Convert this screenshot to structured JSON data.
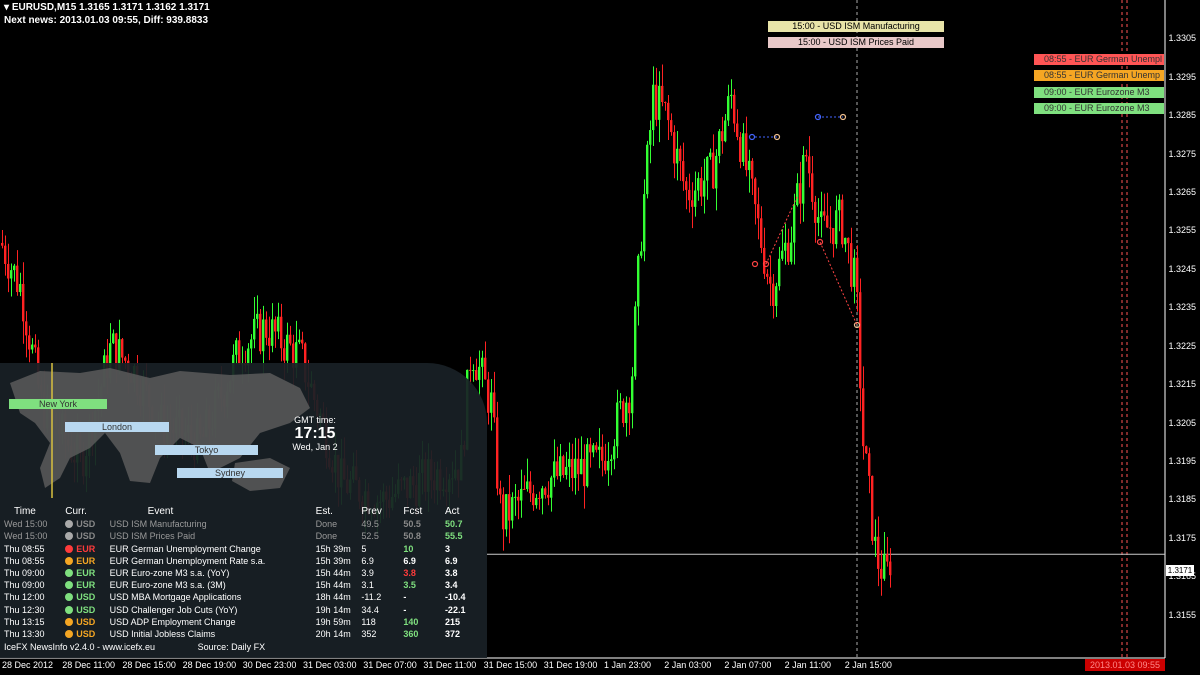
{
  "header": {
    "symbol_line": "EURUSD,M15  1.3165 1.3171 1.3162 1.3171",
    "next_news": "Next news: 2013.01.03 09:55, Diff: 939.8833"
  },
  "colors": {
    "bull": "#33ff33",
    "bear": "#ff2222",
    "background": "#000000",
    "high_impact": "#ff3b3b",
    "medium_impact": "#f5a623",
    "low_impact": "#7fe07f"
  },
  "chart_data": {
    "type": "candlestick",
    "title": "",
    "symbol": "EURUSD",
    "timeframe": "M15",
    "ylim": [
      1.315,
      1.331
    ],
    "current_price": "1.3171",
    "price_ticks": [
      "1.3305",
      "1.3295",
      "1.3285",
      "1.3275",
      "1.3265",
      "1.3255",
      "1.3245",
      "1.3235",
      "1.3225",
      "1.3215",
      "1.3205",
      "1.3195",
      "1.3185",
      "1.3175",
      "1.3165",
      "1.3155"
    ],
    "time_ticks": [
      "28 Dec 2012",
      "28 Dec 11:00",
      "28 Dec 15:00",
      "28 Dec 19:00",
      "30 Dec 23:00",
      "31 Dec 03:00",
      "31 Dec 07:00",
      "31 Dec 11:00",
      "31 Dec 15:00",
      "31 Dec 19:00",
      "1 Jan 23:00",
      "2 Jan 03:00",
      "2 Jan 07:00",
      "2 Jan 11:00",
      "2 Jan 15:00"
    ],
    "server_time": "2013.01.03 09:55"
  },
  "news_markers_top": [
    {
      "label": "15:00 - USD ISM Manufacturing",
      "color": "#e8e4a8"
    },
    {
      "label": "15:00 - USD ISM Prices Paid",
      "color": "#e8c8c8"
    }
  ],
  "news_markers_right": [
    {
      "label": "08:55 - EUR German Unempl",
      "color": "#ff5555"
    },
    {
      "label": "08:55 - EUR German Unemp",
      "color": "#f5a623"
    },
    {
      "label": "09:00 - EUR Eurozone M3",
      "color": "#7fe07f"
    },
    {
      "label": "09:00 - EUR Eurozone M3",
      "color": "#7fe07f"
    }
  ],
  "sessions": [
    {
      "name": "New York",
      "color": "#7fe07f"
    },
    {
      "name": "London",
      "color": "#b8d8f0"
    },
    {
      "name": "Tokyo",
      "color": "#b8d8f0"
    },
    {
      "name": "Sydney",
      "color": "#b8d8f0"
    }
  ],
  "gmt": {
    "label": "GMT time:",
    "time": "17:15",
    "date": "Wed, Jan 2"
  },
  "table": {
    "headers": [
      "Time",
      "Curr.",
      "Event",
      "Est.",
      "Prev",
      "Fcst",
      "Act"
    ],
    "rows": [
      {
        "day": "Wed",
        "time": "15:00",
        "dot": "#aaaaaa",
        "curr": "USD",
        "event": "USD ISM Manufacturing",
        "est": "Done",
        "prev": "49.5",
        "fcst": "50.5",
        "act": "50.7",
        "dim": true,
        "curr_color": "#888888",
        "fcst_color": "#888888",
        "act_color": "#7fe07f"
      },
      {
        "day": "Wed",
        "time": "15:00",
        "dot": "#aaaaaa",
        "curr": "USD",
        "event": "USD ISM Prices Paid",
        "est": "Done",
        "prev": "52.5",
        "fcst": "50.8",
        "act": "55.5",
        "dim": true,
        "curr_color": "#888888",
        "fcst_color": "#888888",
        "act_color": "#7fe07f"
      },
      {
        "day": "Thu",
        "time": "08:55",
        "dot": "#ff3b3b",
        "curr": "EUR",
        "event": "EUR German Unemployment Change",
        "est": "15h 39m",
        "prev": "5",
        "fcst": "10",
        "act": "3",
        "dim": false,
        "curr_color": "#ff3b3b",
        "fcst_color": "#7fe07f",
        "act_color": "#ffffff"
      },
      {
        "day": "Thu",
        "time": "08:55",
        "dot": "#f5a623",
        "curr": "EUR",
        "event": "EUR German Unemployment Rate s.a.",
        "est": "15h 39m",
        "prev": "6.9",
        "fcst": "6.9",
        "act": "6.9",
        "dim": false,
        "curr_color": "#f5a623",
        "fcst_color": "#ffffff",
        "act_color": "#ffffff"
      },
      {
        "day": "Thu",
        "time": "09:00",
        "dot": "#7fe07f",
        "curr": "EUR",
        "event": "EUR Euro-zone M3 s.a. (YoY)",
        "est": "15h 44m",
        "prev": "3.9",
        "fcst": "3.8",
        "act": "3.8",
        "dim": false,
        "curr_color": "#7fe07f",
        "fcst_color": "#ff3b3b",
        "act_color": "#ffffff"
      },
      {
        "day": "Thu",
        "time": "09:00",
        "dot": "#7fe07f",
        "curr": "EUR",
        "event": "EUR Euro-zone M3 s.a. (3M)",
        "est": "15h 44m",
        "prev": "3.1",
        "fcst": "3.5",
        "act": "3.4",
        "dim": false,
        "curr_color": "#7fe07f",
        "fcst_color": "#7fe07f",
        "act_color": "#ffffff"
      },
      {
        "day": "Thu",
        "time": "12:00",
        "dot": "#7fe07f",
        "curr": "USD",
        "event": "USD MBA Mortgage Applications",
        "est": "18h 44m",
        "prev": "-11.2",
        "fcst": "-",
        "act": "-10.4",
        "dim": false,
        "curr_color": "#7fe07f",
        "fcst_color": "#ffffff",
        "act_color": "#ffffff"
      },
      {
        "day": "Thu",
        "time": "12:30",
        "dot": "#7fe07f",
        "curr": "USD",
        "event": "USD Challenger Job Cuts (YoY)",
        "est": "19h 14m",
        "prev": "34.4",
        "fcst": "-",
        "act": "-22.1",
        "dim": false,
        "curr_color": "#7fe07f",
        "fcst_color": "#ffffff",
        "act_color": "#ffffff"
      },
      {
        "day": "Thu",
        "time": "13:15",
        "dot": "#f5a623",
        "curr": "USD",
        "event": "USD ADP Employment Change",
        "est": "19h 59m",
        "prev": "118",
        "fcst": "140",
        "act": "215",
        "dim": false,
        "curr_color": "#f5a623",
        "fcst_color": "#7fe07f",
        "act_color": "#ffffff"
      },
      {
        "day": "Thu",
        "time": "13:30",
        "dot": "#f5a623",
        "curr": "USD",
        "event": "USD Initial Jobless Claims",
        "est": "20h 14m",
        "prev": "352",
        "fcst": "360",
        "act": "372",
        "dim": false,
        "curr_color": "#f5a623",
        "fcst_color": "#7fe07f",
        "act_color": "#ffffff"
      }
    ]
  },
  "footer": {
    "version": "IceFX NewsInfo v2.4.0  -  www.icefx.eu",
    "source": "Source: Daily FX"
  }
}
